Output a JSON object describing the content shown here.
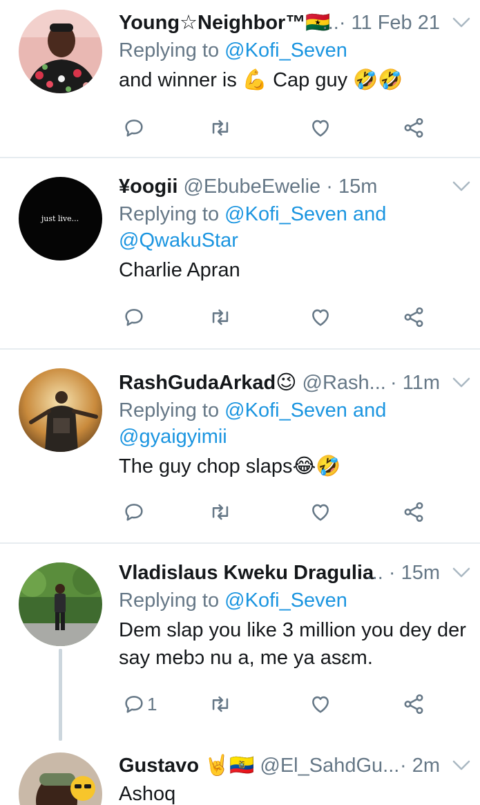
{
  "tweets": [
    {
      "display_name": "Young☆Neighbor™🇬🇭",
      "ellipsis": "...",
      "dot": "·",
      "time": "11 Feb 21",
      "replying_prefix": "Replying to ",
      "replying_to": "@Kofi_Seven",
      "body": "and winner is 💪 Cap guy 🤣🤣",
      "reply_count": ""
    },
    {
      "display_name": "¥oogii",
      "handle": "@EbubeEwelie",
      "dot": "·",
      "time": "15m",
      "replying_prefix": "Replying to ",
      "replying_to": "@Kofi_Seven and",
      "replying_to_2": "@QwakuStar",
      "body": "Charlie Apran",
      "avatar_text": "just live...",
      "reply_count": ""
    },
    {
      "display_name": "RashGudaArkad😉",
      "handle": "@Rash...",
      "dot": "·",
      "time": "11m",
      "replying_prefix": "Replying to ",
      "replying_to": "@Kofi_Seven and",
      "replying_to_2": "@gyaigyimii",
      "body": "The guy chop slaps😂🤣",
      "reply_count": ""
    },
    {
      "display_name": "Vladislaus Kweku Dragulia",
      "ellipsis": "...",
      "dot": "·",
      "time": "15m",
      "replying_prefix": "Replying to ",
      "replying_to": "@Kofi_Seven",
      "body": "Dem slap you like 3 million you dey der",
      "body_2": "say mebɔ nu a, me ya asɛm.",
      "reply_count": "1"
    },
    {
      "display_name": "Gustavo 🤘🇪🇨",
      "handle": "@El_SahdGu...",
      "dot": "·",
      "time": "2m",
      "body": "Ashoq"
    }
  ],
  "colors": {
    "text": "#14171a",
    "muted": "#657786",
    "link": "#1b95e0",
    "divider": "#e6ecf0",
    "thread_line": "#ccd6dd"
  },
  "icons": [
    "reply-icon",
    "retweet-icon",
    "like-icon",
    "share-icon",
    "chevron-down-icon"
  ]
}
